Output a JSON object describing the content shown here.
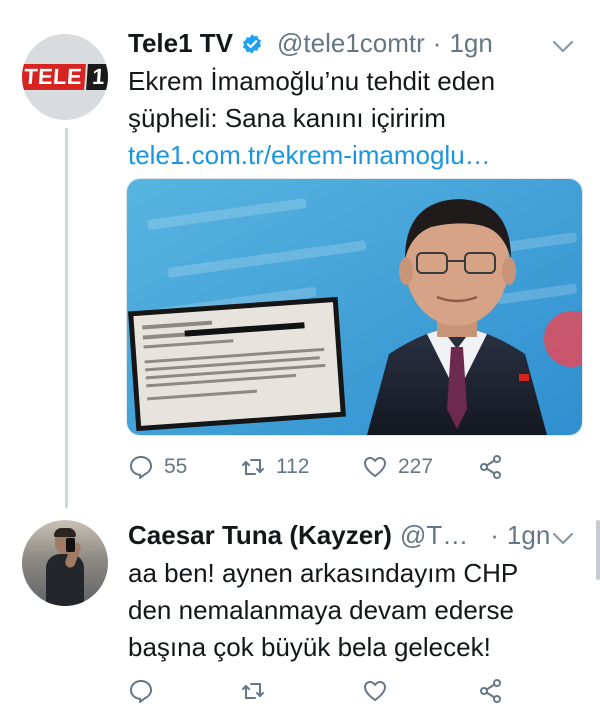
{
  "tweet1": {
    "author_name": "Tele1 TV",
    "handle": "@tele1comtr",
    "separator": "·",
    "time": "1gn",
    "avatar_logo_text": "TELE",
    "avatar_logo_number": "1",
    "text_line1": "Ekrem İmamoğlu’nu tehdit eden",
    "text_line2": "şüpheli: Sana kanını içiririm",
    "link": "tele1.com.tr/ekrem-imamoglu…",
    "replies": "55",
    "retweets": "112",
    "likes": "227"
  },
  "tweet2": {
    "author_name": "Caesar Tuna (Kayzer)",
    "handle": "@T…",
    "separator": "·",
    "time": "1gn",
    "text_line1": "aa ben! aynen arkasındayım CHP",
    "text_line2": "den nemalanmaya devam ederse",
    "text_line3": "başına çok büyük bela gelecek!"
  },
  "colors": {
    "link": "#1b95e0",
    "verified": "#1da1f2",
    "muted": "#657786",
    "brand_red": "#d62420"
  },
  "icons": [
    "verified-badge-icon",
    "chevron-down-icon",
    "reply-icon",
    "retweet-icon",
    "like-icon",
    "share-icon"
  ]
}
